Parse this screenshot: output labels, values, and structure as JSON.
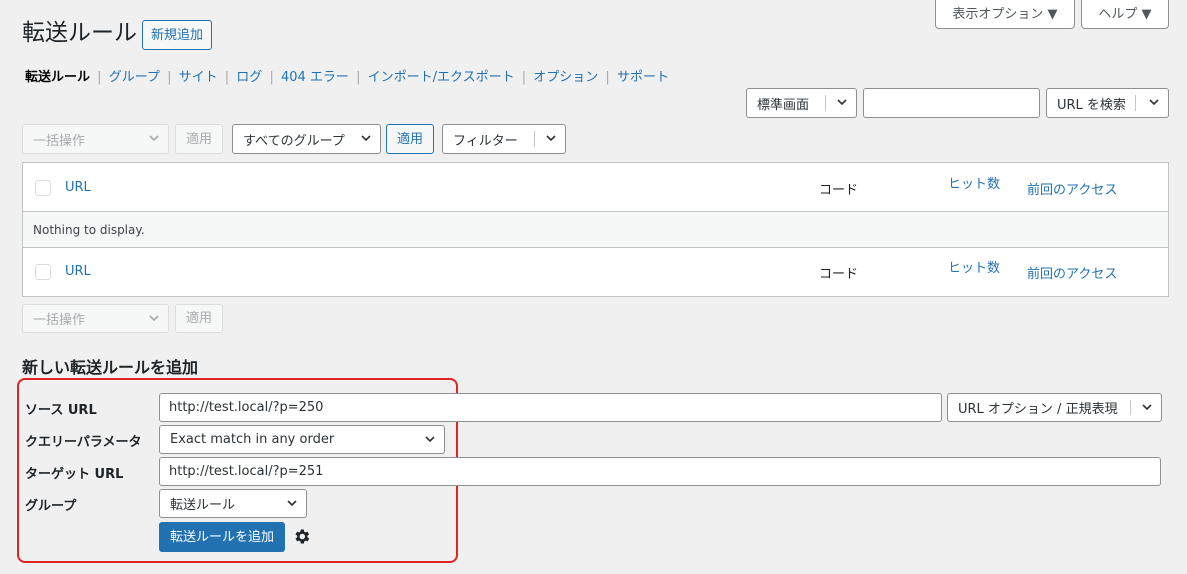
{
  "page": {
    "title": "転送ルール",
    "add_new": "新規追加",
    "screen_options": "表示オプション ▼",
    "help": "ヘルプ ▼"
  },
  "subnav": {
    "items": [
      "転送ルール",
      "グループ",
      "サイト",
      "ログ",
      "404 エラー",
      "インポート/エクスポート",
      "オプション",
      "サポート"
    ],
    "separator": "|"
  },
  "search": {
    "view_select": "標準画面",
    "query": "",
    "search_button": "URL を検索"
  },
  "tablenav_top": {
    "bulk": "一括操作",
    "apply": "適用",
    "group_filter": "すべてのグループ",
    "apply2": "適用",
    "filter": "フィルター"
  },
  "table": {
    "columns": {
      "url": "URL",
      "code": "コード",
      "hits": "ヒット数",
      "last_access": "前回のアクセス"
    },
    "empty": "Nothing to display."
  },
  "tablenav_bottom": {
    "bulk": "一括操作",
    "apply": "適用"
  },
  "add_form": {
    "heading": "新しい転送ルールを追加",
    "source_label": "ソース URL",
    "source_value": "http://test.local/?p=250",
    "url_options": "URL オプション / 正規表現",
    "query_label": "クエリーパラメータ",
    "query_value": "Exact match in any order",
    "target_label": "ターゲット URL",
    "target_value": "http://test.local/?p=251",
    "group_label": "グループ",
    "group_value": "転送ルール",
    "submit": "転送ルールを追加"
  },
  "colors": {
    "accent": "#2271b1",
    "highlight_border": "#e02424",
    "background": "#f0f0f1"
  },
  "icons": {
    "chevron": "chevron-down-icon",
    "gear": "gear-icon"
  }
}
